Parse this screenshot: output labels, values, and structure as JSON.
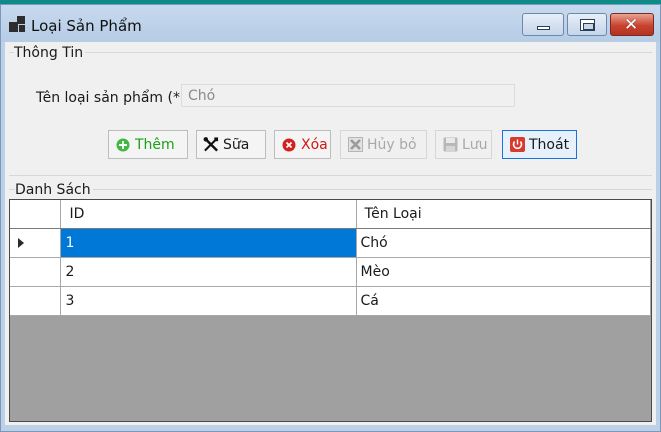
{
  "window": {
    "title": "Loại Sản Phẩm",
    "close_glyph": "✕"
  },
  "info_group": {
    "title": "Thông Tin",
    "label": "Tên loại sản phẩm (*):",
    "value": "Chó"
  },
  "toolbar": {
    "add_label": "Thêm",
    "edit_label": "Sữa",
    "delete_label": "Xóa",
    "cancel_label": "Hủy bỏ",
    "save_label": "Lưu",
    "exit_label": "Thoát"
  },
  "list_group": {
    "title": "Danh Sách",
    "columns": [
      "ID",
      "Tên Loại"
    ],
    "rows": [
      {
        "id": "1",
        "name": "Chó"
      },
      {
        "id": "2",
        "name": "Mèo"
      },
      {
        "id": "3",
        "name": "Cá"
      }
    ],
    "selected_row": 0
  },
  "colors": {
    "selection": "#0078d7",
    "add": "#1aa11a",
    "delete": "#d21818",
    "disabled": "#a9a9a9",
    "focus_border": "#1a73d9"
  }
}
